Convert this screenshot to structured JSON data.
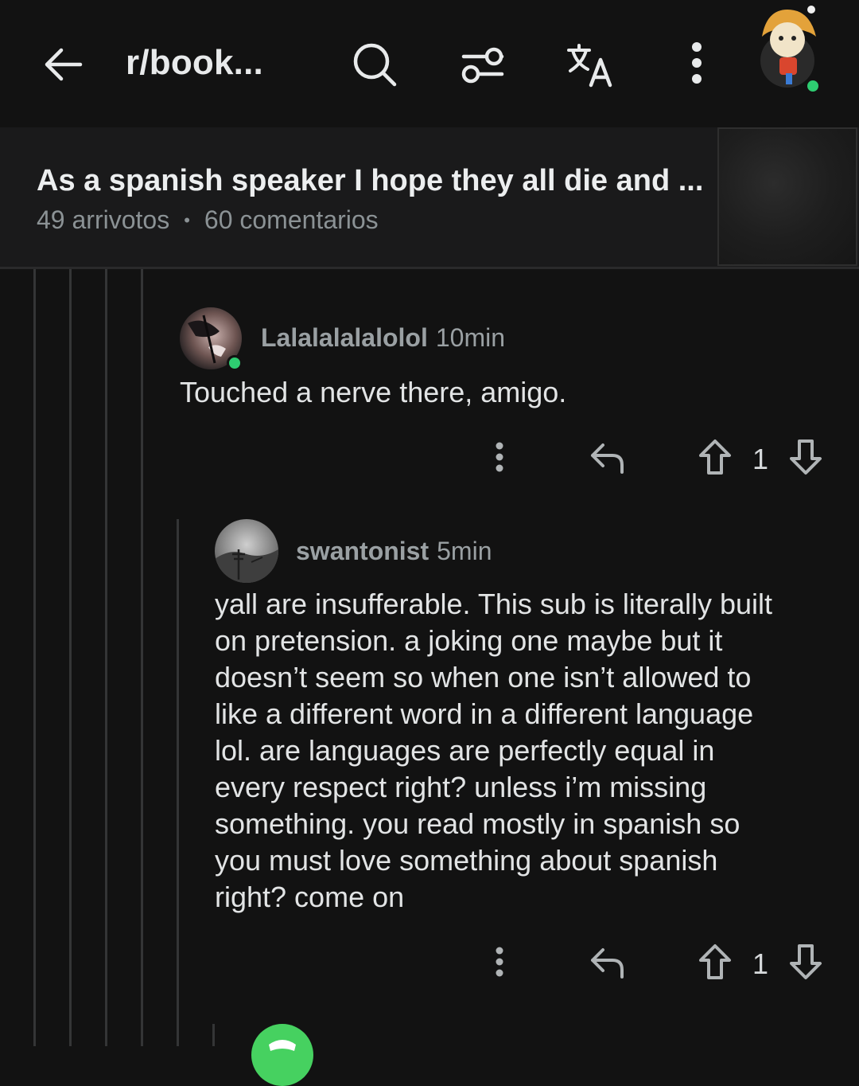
{
  "header": {
    "subreddit": "r/book...",
    "icons": [
      "back-arrow-icon",
      "search-icon",
      "filter-icon",
      "translate-icon",
      "more-vertical-icon"
    ]
  },
  "post": {
    "title": "As a spanish speaker I hope they all die and ...",
    "upvotes": "49 arrivotos",
    "separator": "•",
    "comments": "60 comentarios"
  },
  "comments": [
    {
      "username": "Lalalalalalolol",
      "time": "10min",
      "body": "Touched a nerve there, amigo.",
      "score": "1"
    },
    {
      "username": "swantonist",
      "time": "5min",
      "body_lines": [
        "yall are insufferable. This sub is literally built",
        "on pretension. a joking one maybe but it",
        "doesn’t  seem so when one isn’t allowed to",
        "like a different word in a different language",
        "lol. are languages are perfectly equal in",
        "every respect right? unless i’m missing",
        "something. you read mostly in spanish so",
        "you must love something about spanish",
        "right? come on"
      ],
      "score": "1"
    }
  ],
  "colors": {
    "background": "#121212",
    "header_bg": "#1a1a1b",
    "online": "#2ecc71",
    "thread_line": "#343536"
  }
}
